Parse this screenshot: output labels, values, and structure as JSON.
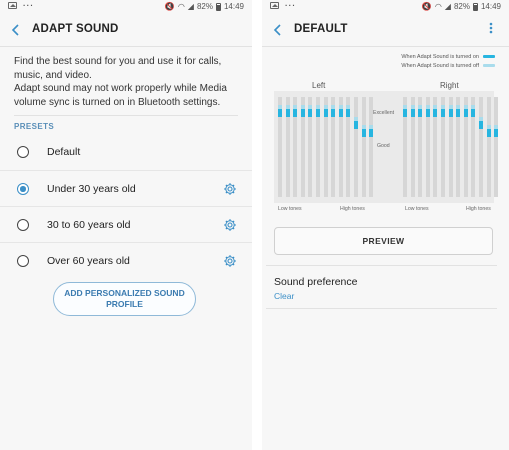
{
  "status_bar": {
    "battery": "82%",
    "time": "14:49"
  },
  "left": {
    "title": "ADAPT SOUND",
    "description_1": "Find the best sound for you and use it for calls, music, and video.",
    "description_2": "Adapt sound may not work properly while Media volume sync is turned on in Bluetooth settings.",
    "presets_header": "PRESETS",
    "options": [
      {
        "label": "Default",
        "selected": false,
        "has_settings": false
      },
      {
        "label": "Under 30 years old",
        "selected": true,
        "has_settings": true
      },
      {
        "label": "30 to 60 years old",
        "selected": false,
        "has_settings": true
      },
      {
        "label": "Over 60 years old",
        "selected": false,
        "has_settings": true
      }
    ],
    "add_button": "ADD PERSONALIZED SOUND PROFILE",
    "accent_color": "#3b8fc7"
  },
  "right": {
    "title": "DEFAULT",
    "legend": {
      "on": "When Adapt Sound is turned on",
      "off": "When Adapt Sound is turned off",
      "on_color": "#27b5e0",
      "off_color": "#a9dcec"
    },
    "left_label": "Left",
    "right_label": "Right",
    "excellent_label": "Excellent",
    "good_label": "Good",
    "low_tones": "Low tones",
    "high_tones": "High tones",
    "preview_button": "PREVIEW",
    "sound_preference_title": "Sound preference",
    "sound_preference_value": "Clear"
  },
  "chart_data": [
    {
      "type": "bar",
      "title": "Left",
      "xlabel_start": "Low tones",
      "xlabel_end": "High tones",
      "levels": [
        "Excellent",
        "Good"
      ],
      "series": [
        {
          "name": "When Adapt Sound is turned on",
          "values": [
            0.92,
            0.92,
            0.92,
            0.92,
            0.92,
            0.92,
            0.92,
            0.92,
            0.92,
            0.92,
            0.8,
            0.72,
            0.72
          ]
        }
      ]
    },
    {
      "type": "bar",
      "title": "Right",
      "xlabel_start": "Low tones",
      "xlabel_end": "High tones",
      "levels": [
        "Excellent",
        "Good"
      ],
      "series": [
        {
          "name": "When Adapt Sound is turned on",
          "values": [
            0.92,
            0.92,
            0.92,
            0.92,
            0.92,
            0.92,
            0.92,
            0.92,
            0.92,
            0.92,
            0.8,
            0.72,
            0.72
          ]
        }
      ]
    }
  ]
}
